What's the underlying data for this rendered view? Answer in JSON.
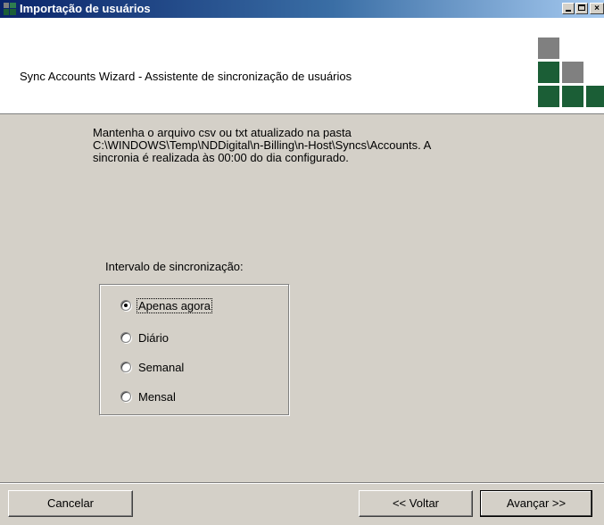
{
  "window": {
    "title": "Importação de usuários",
    "minimize": "",
    "maximize": "",
    "close": "×"
  },
  "header": {
    "title": "Sync Accounts Wizard - Assistente de sincronização de usuários"
  },
  "description": {
    "line1": "Mantenha o arquivo csv ou txt atualizado na pasta",
    "line2": "C:\\WINDOWS\\Temp\\NDDigital\\n-Billing\\n-Host\\Syncs\\Accounts. A",
    "line3": "sincronia é realizada às 00:00 do dia configurado."
  },
  "interval": {
    "label": "Intervalo de sincronização:",
    "options": [
      {
        "label": "Apenas agora",
        "checked": true
      },
      {
        "label": "Diário",
        "checked": false
      },
      {
        "label": "Semanal",
        "checked": false
      },
      {
        "label": "Mensal",
        "checked": false
      }
    ]
  },
  "footer": {
    "cancel": "Cancelar",
    "back": "<< Voltar",
    "next": "Avançar >>"
  }
}
